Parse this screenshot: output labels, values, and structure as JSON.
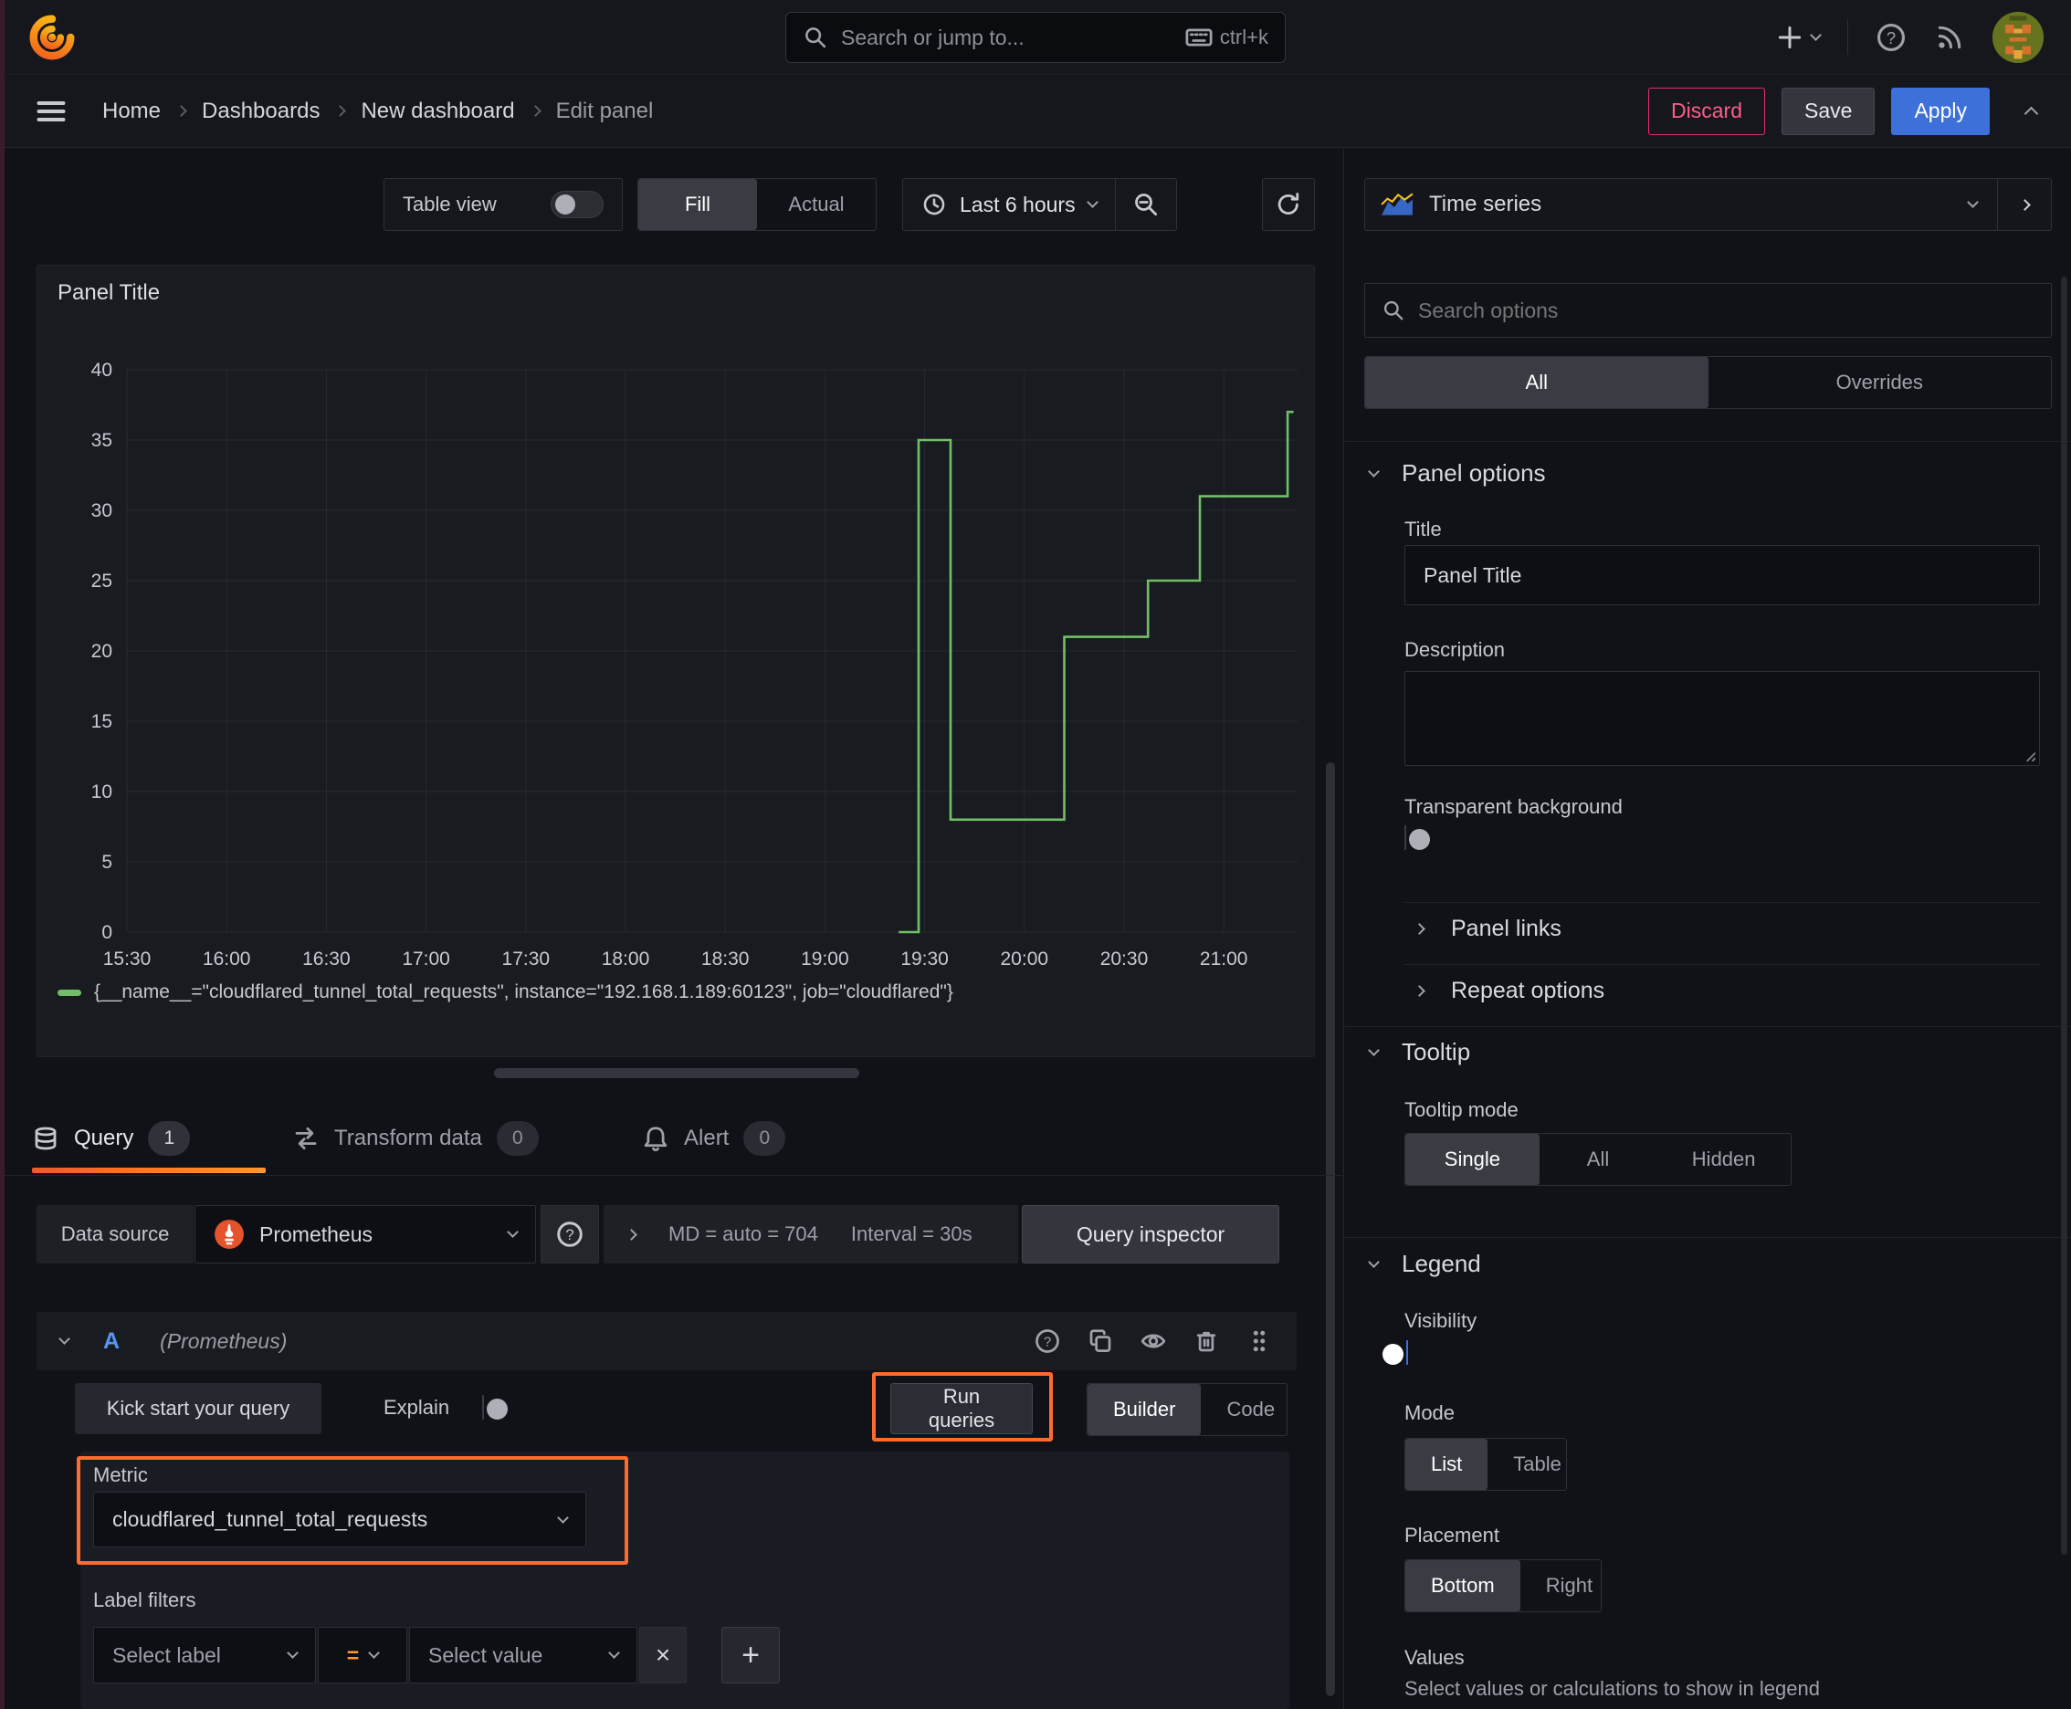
{
  "colors": {
    "accent_orange": "#ff780a",
    "annotation_orange": "#ff6b2e",
    "primary_blue": "#3d71d9",
    "destructive_pink": "#e02f6c",
    "series_green": "#73bf69"
  },
  "topbar": {
    "search_placeholder": "Search or jump to...",
    "search_shortcut": "ctrl+k"
  },
  "breadcrumb": {
    "items": [
      "Home",
      "Dashboards",
      "New dashboard",
      "Edit panel"
    ]
  },
  "actions": {
    "discard": "Discard",
    "save": "Save",
    "apply": "Apply"
  },
  "panel_toolbar": {
    "table_view": "Table view",
    "fill": "Fill",
    "actual": "Actual",
    "time_range": "Last 6 hours"
  },
  "panel": {
    "title": "Panel Title",
    "legend_label": "{__name__=\"cloudflared_tunnel_total_requests\", instance=\"192.168.1.189:60123\", job=\"cloudflared\"}"
  },
  "chart_data": {
    "type": "line",
    "line_style": "stepped",
    "title": "Panel Title",
    "xlabel": "",
    "ylabel": "",
    "ylim": [
      0,
      40
    ],
    "y_tick_step": 5,
    "x_range_hours": [
      15.5,
      21.37
    ],
    "x_ticks": [
      "15:30",
      "16:00",
      "16:30",
      "17:00",
      "17:30",
      "18:00",
      "18:30",
      "19:00",
      "19:30",
      "20:00",
      "20:30",
      "21:00"
    ],
    "x_tick_hours": [
      15.5,
      16,
      16.5,
      17,
      17.5,
      18,
      18.5,
      19,
      19.5,
      20,
      20.5,
      21
    ],
    "grid": true,
    "legend_position": "bottom",
    "series": [
      {
        "name": "{__name__=\"cloudflared_tunnel_total_requests\", instance=\"192.168.1.189:60123\", job=\"cloudflared\"}",
        "color": "#73bf69",
        "step_points_hour_value": [
          [
            19.37,
            0
          ],
          [
            19.47,
            35
          ],
          [
            19.63,
            8
          ],
          [
            20.2,
            21
          ],
          [
            20.62,
            25
          ],
          [
            20.88,
            31
          ],
          [
            21.32,
            37
          ]
        ],
        "end_hour": 21.35
      }
    ]
  },
  "query_section": {
    "tabs": [
      {
        "label": "Query",
        "count": "1"
      },
      {
        "label": "Transform data",
        "count": "0"
      },
      {
        "label": "Alert",
        "count": "0"
      }
    ],
    "datasource": {
      "label": "Data source",
      "value": "Prometheus",
      "options_md": "MD = auto = 704",
      "options_interval": "Interval = 30s",
      "query_inspector": "Query inspector"
    },
    "query_row": {
      "ref_id": "A",
      "datasource_hint": "(Prometheus)"
    },
    "toolbar": {
      "kick_start": "Kick start your query",
      "explain": "Explain",
      "run_queries": "Run queries",
      "builder": "Builder",
      "code": "Code"
    },
    "metric": {
      "label": "Metric",
      "value": "cloudflared_tunnel_total_requests"
    },
    "label_filters": {
      "label": "Label filters",
      "select_label_placeholder": "Select label",
      "operator": "=",
      "select_value_placeholder": "Select value"
    }
  },
  "sidebar": {
    "visualization": "Time series",
    "search_placeholder": "Search options",
    "tabs": {
      "all": "All",
      "overrides": "Overrides"
    },
    "panel_options": {
      "heading": "Panel options",
      "title_label": "Title",
      "title_value": "Panel Title",
      "description_label": "Description",
      "transparent_bg_label": "Transparent background"
    },
    "collapsed_sections": {
      "panel_links": "Panel links",
      "repeat_options": "Repeat options"
    },
    "tooltip": {
      "heading": "Tooltip",
      "mode_label": "Tooltip mode",
      "modes": [
        "Single",
        "All",
        "Hidden"
      ],
      "active_mode": "Single"
    },
    "legend": {
      "heading": "Legend",
      "visibility_label": "Visibility",
      "mode_label": "Mode",
      "modes": [
        "List",
        "Table"
      ],
      "active_mode": "List",
      "placement_label": "Placement",
      "placements": [
        "Bottom",
        "Right"
      ],
      "active_placement": "Bottom",
      "values_label": "Values",
      "values_desc": "Select values or calculations to show in legend"
    }
  }
}
